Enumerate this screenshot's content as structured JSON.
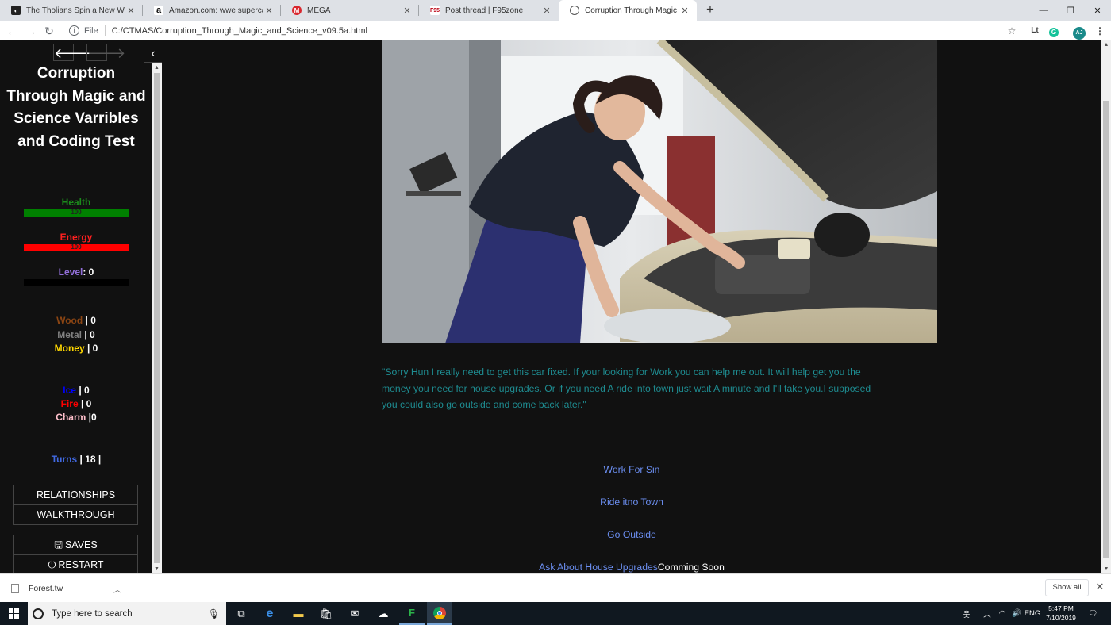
{
  "browser": {
    "tabs": [
      {
        "title": "The Tholians Spin a New Web | S",
        "favicon": "tholians-favicon",
        "active": false
      },
      {
        "title": "Amazon.com: wwe supercard",
        "favicon": "amazon-favicon",
        "active": false
      },
      {
        "title": "MEGA",
        "favicon": "mega-favicon",
        "active": false
      },
      {
        "title": "Post thread | F95zone",
        "favicon": "f95-favicon",
        "active": false
      },
      {
        "title": "Corruption Through Magic and S",
        "favicon": "globe-favicon",
        "active": true
      }
    ],
    "new_tab": "+",
    "scheme": "File",
    "url": "C:/CTMAS/Corruption_Through_Magic_and_Science_v09.5a.html",
    "profile_initials": "AJ"
  },
  "sidebar": {
    "title": "Corruption Through Magic and Science Varribles and Coding Test",
    "health": {
      "label": "Health",
      "value": "100",
      "fill_fraction": 1.0,
      "color": "#008000"
    },
    "energy": {
      "label": "Energy",
      "value": "100",
      "fill_fraction": 1.0,
      "color": "#ff0000"
    },
    "level": {
      "label": "Level",
      "value": ": 0",
      "fill_fraction": 0.0
    },
    "resources": {
      "wood": {
        "label": "Wood",
        "value": " | 0",
        "color": "#8b4513"
      },
      "metal": {
        "label": "Metal",
        "value": " | 0",
        "color": "#808080"
      },
      "money": {
        "label": "Money",
        "value": " | 0",
        "color": "#ffd700"
      }
    },
    "magic": {
      "ice": {
        "label": "Ice",
        "value": " | 0",
        "color": "#0000ff"
      },
      "fire": {
        "label": "Fire",
        "value": " | 0",
        "color": "#ff0000"
      },
      "charm": {
        "label": "Charm",
        "value": " |0",
        "color": "#ffc0cb"
      }
    },
    "turns": {
      "label": "Turns",
      "value": " | 18 |",
      "color": "#4169e1"
    },
    "menu": {
      "relationships": "RELATIONSHIPS",
      "walkthrough": "WALKTHROUGH",
      "saves": "SAVES",
      "restart": "RESTART"
    }
  },
  "passage": {
    "image_alt": "Mechanic woman leaning over open car hood",
    "dialog": "\"Sorry Hun I really need to get this car fixed. If your looking for Work you can help me out. It will help get you the money you need for house upgrades. Or if you need A ride into town just wait A minute and I'll take you.I supposed you could also go outside and come back later.\"",
    "choices": [
      {
        "label": "Work For Sin"
      },
      {
        "label": "Ride itno Town"
      },
      {
        "label": "Go Outside"
      },
      {
        "label": "Ask About House Upgrades",
        "suffix": "Comming Soon"
      }
    ]
  },
  "downloads": {
    "file": "Forest.tw",
    "show_all": "Show all"
  },
  "taskbar": {
    "search_placeholder": "Type here to search",
    "language": "ENG",
    "time": "5:47 PM",
    "date": "7/10/2019"
  }
}
